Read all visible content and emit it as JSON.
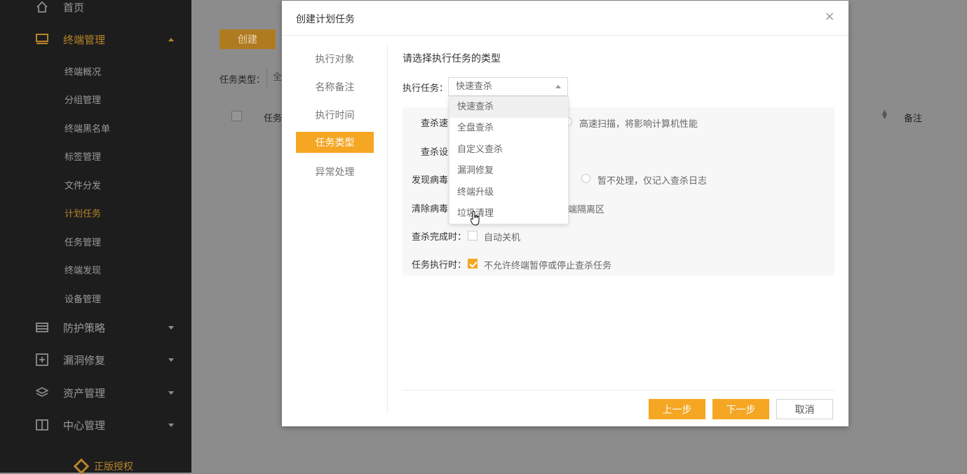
{
  "sidebar": {
    "home": "首页",
    "terminal_mgmt": "终端管理",
    "sub_items": [
      "终端概况",
      "分组管理",
      "终端黑名单",
      "标签管理",
      "文件分发",
      "计划任务",
      "任务管理",
      "终端发现",
      "设备管理"
    ],
    "active_sub": "计划任务",
    "protection": "防护策略",
    "vuln_fix": "漏洞修复",
    "asset_mgmt": "资产管理",
    "center_mgmt": "中心管理",
    "license": "正版授权"
  },
  "background": {
    "create_button": "创建",
    "filter_label": "任务类型：",
    "filter_value": "全",
    "col_task": "任务",
    "col_note": "备注"
  },
  "modal": {
    "title": "创建计划任务",
    "close": "×",
    "steps": [
      "执行对象",
      "名称备注",
      "执行时间",
      "任务类型",
      "异常处理"
    ],
    "active_step": "任务类型",
    "section_title": "请选择执行任务的类型",
    "task_label": "执行任务：",
    "task_selected": "快速查杀",
    "dropdown_options": [
      "快速查杀",
      "全盘查杀",
      "自定义查杀",
      "漏洞修复",
      "终端升级",
      "垃圾清理"
    ],
    "options": {
      "scan_speed_label": "查杀速",
      "scan_speed_high": "高速扫描，将影响计算机性能",
      "scan_settings_label": "查杀设",
      "found_virus_label": "发现病毒",
      "found_virus_option": "暂不处理，仅记入查杀日志",
      "clear_virus_label": "清除病毒",
      "clear_virus_option": "端隔离区",
      "on_complete_label": "查杀完成时：",
      "on_complete_option": "自动关机",
      "on_running_label": "任务执行时：",
      "on_running_option": "不允许终端暂停或停止查杀任务"
    },
    "buttons": {
      "prev": "上一步",
      "next": "下一步",
      "cancel": "取消"
    }
  },
  "colors": {
    "accent": "#f5a623",
    "sidebar_bg": "#1d1d1d",
    "sidebar_active": "#b7832a"
  }
}
